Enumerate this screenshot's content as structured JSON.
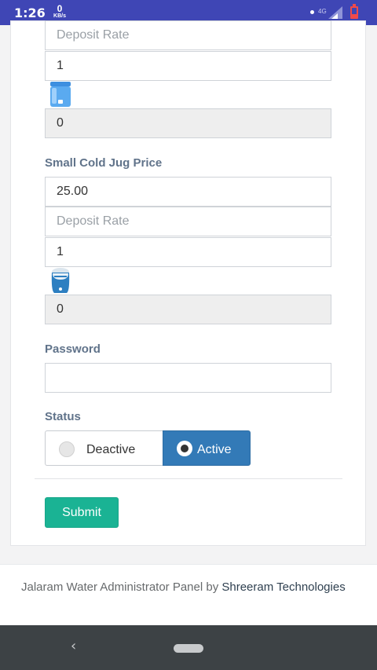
{
  "status_bar": {
    "time": "1:26",
    "net_speed_value": "0",
    "net_speed_unit": "KB/s",
    "network_type": "4G",
    "signal_icon": "signal-icon",
    "battery_icon": "battery-low-icon"
  },
  "form": {
    "large_jug": {
      "deposit_rate_placeholder": "Deposit Rate",
      "quantity_value": "1",
      "icon": "large-water-jug-icon",
      "total_value": "0"
    },
    "small_cold_jug": {
      "label": "Small Cold Jug Price",
      "price_value": "25.00",
      "deposit_rate_placeholder": "Deposit Rate",
      "quantity_value": "1",
      "icon": "small-cold-jug-icon",
      "total_value": "0"
    },
    "password": {
      "label": "Password",
      "value": ""
    },
    "status": {
      "label": "Status",
      "options": [
        "Deactive",
        "Active"
      ],
      "selected": "Active"
    },
    "submit_label": "Submit"
  },
  "footer": {
    "text": "Jalaram Water Administrator Panel by ",
    "company": "Shreeram Technologies"
  },
  "colors": {
    "status_bar": "#3f46b5",
    "primary": "#337ab7",
    "submit": "#1ab394",
    "label": "#60738a",
    "nav_bar": "#3d4245"
  },
  "nav_bar": {
    "back_icon": "back-chevron-icon",
    "home_icon": "home-pill-icon"
  }
}
